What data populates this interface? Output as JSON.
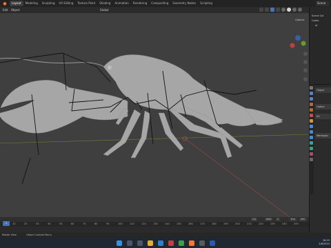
{
  "app": {
    "workspace_tabs": [
      "Layout",
      "Modeling",
      "Sculpting",
      "UV Editing",
      "Texture Paint",
      "Shading",
      "Animation",
      "Rendering",
      "Compositing",
      "Geometry Nodes",
      "Scripting"
    ],
    "active_tab": "Layout",
    "scene_label": "Scene"
  },
  "viewport_header": {
    "mode_items": [
      "Edit",
      "Object"
    ],
    "orientation": "Global",
    "options_label": "Options"
  },
  "outliner": {
    "rows": [
      "Scene Col",
      "Collec",
      "Ar"
    ]
  },
  "properties": {
    "panels": [
      "Object",
      "Option",
      "Ed",
      "Workspac"
    ]
  },
  "timeline": {
    "current_frame": "1",
    "tick_labels": [
      "10",
      "20",
      "30",
      "40",
      "50",
      "60",
      "70",
      "80",
      "90",
      "100",
      "110",
      "120",
      "130",
      "140",
      "150",
      "160",
      "170",
      "180",
      "190",
      "200",
      "210",
      "220",
      "230",
      "240",
      "250"
    ],
    "start_label": "Start",
    "start_value": "1",
    "end_label": "End",
    "end_value": "250",
    "frame_field": "4.0"
  },
  "statusbar": {
    "items": [
      "Rotate View",
      "Object Context Menu"
    ]
  },
  "taskbar": {
    "time": "18:19",
    "date": "2/6/2024"
  },
  "colors": {
    "viewport_bg": "#3f3f3f",
    "accent": "#4772b3",
    "blender_orange": "#f5792a"
  }
}
